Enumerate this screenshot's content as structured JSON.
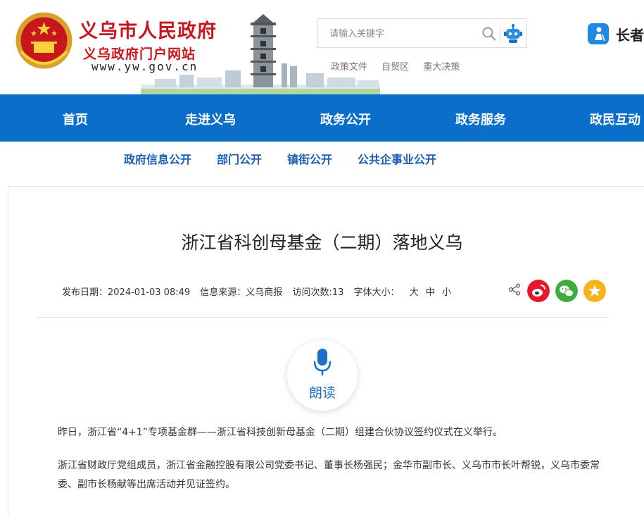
{
  "header": {
    "site_name": "义乌市人民政府",
    "site_sub": "义乌政府门户网站",
    "site_url": "www.yw.gov.cn",
    "search_placeholder": "请输入关键字",
    "quick_links": [
      "政策文件",
      "自贸区",
      "重大决策"
    ],
    "elder_label": "长者"
  },
  "nav": {
    "items": [
      "首页",
      "走进义乌",
      "政务公开",
      "政务服务",
      "政民互动"
    ]
  },
  "subnav": {
    "items": [
      "政府信息公开",
      "部门公开",
      "镇街公开",
      "公共企事业公开"
    ]
  },
  "article": {
    "title": "浙江省科创母基金（二期）落地义乌",
    "publish_label": "发布日期：2024-01-03 08:49",
    "source_label": "信息来源：义乌商报",
    "visits_label": "访问次数:13",
    "fontsize_label": "字体大小：",
    "fontsize_options": [
      "大",
      "中",
      "小"
    ],
    "read_label": "朗读",
    "paragraphs": [
      "昨日，浙江省“4+1”专项基金群——浙江省科技创新母基金（二期）组建合伙协议签约仪式在义举行。",
      "浙江省财政厅党组成员，浙江省金融控股有限公司党委书记、董事长杨强民；金华市副市长、义乌市市长叶帮锐，义乌市委常委、副市长杨献等出席活动并见证签约。"
    ]
  },
  "colors": {
    "brand_red": "#c8161d",
    "nav_blue": "#0a6fc8",
    "weibo": "#e6162d",
    "wechat": "#3dae3b",
    "favorite": "#f4b41a"
  },
  "icons": [
    "national-emblem-icon",
    "search-icon",
    "robot-icon",
    "elder-mode-icon",
    "share-icon",
    "weibo-icon",
    "wechat-icon",
    "favorite-icon",
    "microphone-icon"
  ]
}
